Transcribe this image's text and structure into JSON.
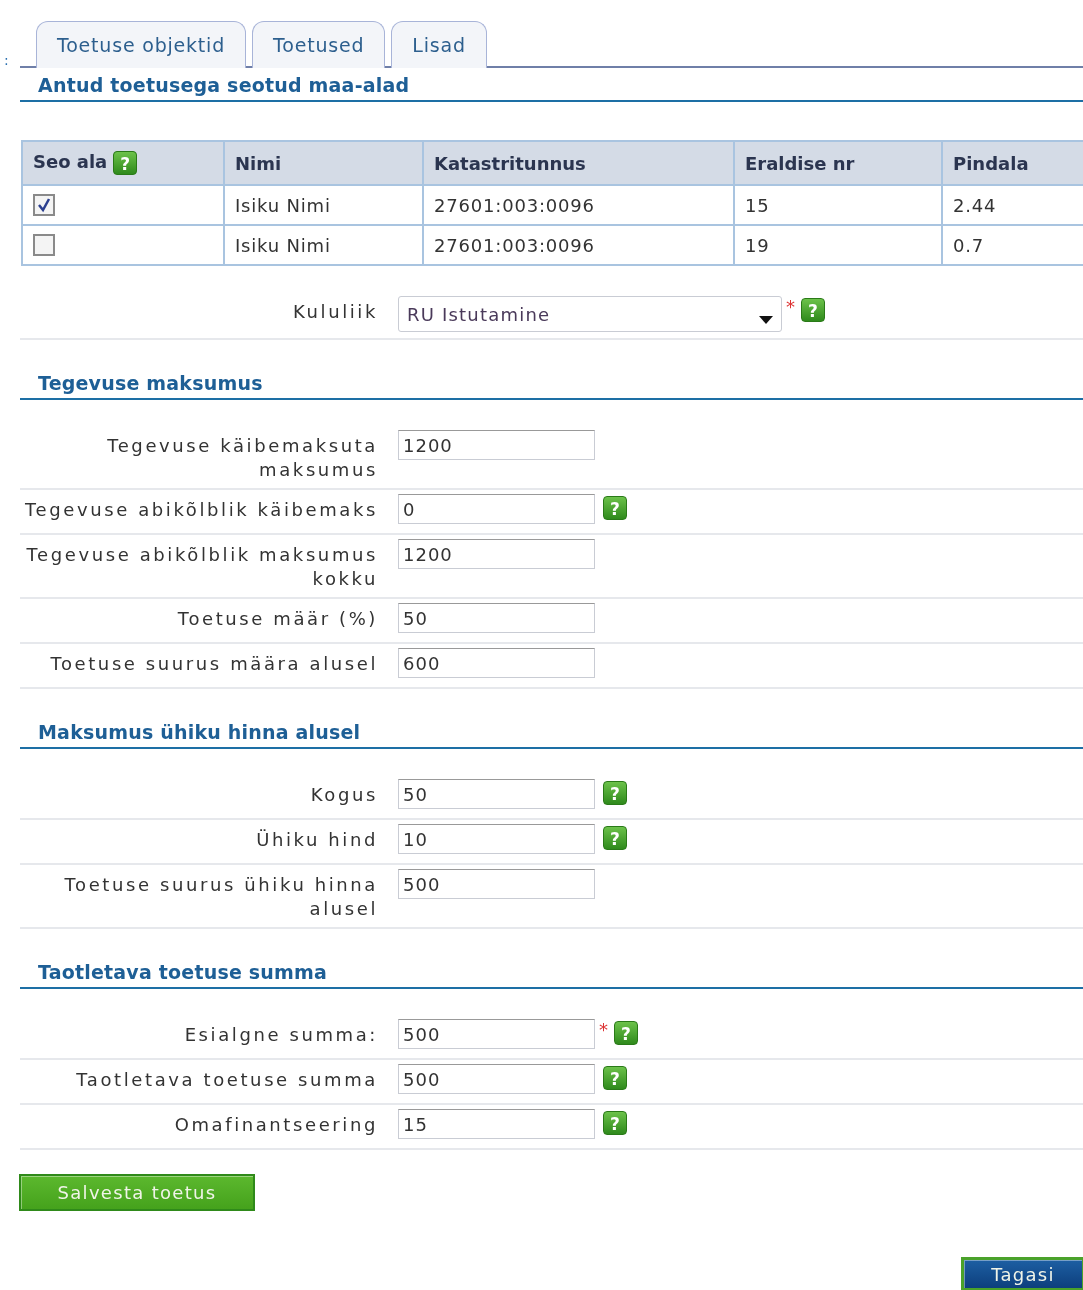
{
  "edge_mark": ":",
  "tabs": [
    {
      "label": "Toetuse objektid"
    },
    {
      "label": "Toetused"
    },
    {
      "label": "Lisad"
    }
  ],
  "land_section": {
    "title": "Antud toetusega seotud maa-alad"
  },
  "table": {
    "columns": [
      {
        "label": "Seo ala",
        "help": "?"
      },
      {
        "label": "Nimi"
      },
      {
        "label": "Katastritunnus"
      },
      {
        "label": "Eraldise nr"
      },
      {
        "label": "Pindala"
      }
    ],
    "rows": [
      {
        "cells": [
          {
            "kind": "checkbox",
            "checked": true
          },
          "Isiku Nimi",
          "27601:003:0096",
          "15",
          "2.44"
        ]
      },
      {
        "cells": [
          {
            "kind": "checkbox",
            "checked": false
          },
          "Isiku Nimi",
          "27601:003:0096",
          "19",
          "0.7"
        ]
      }
    ]
  },
  "cost_type": {
    "label": "Kululiik",
    "value": "RU Istutamine",
    "required": "*",
    "help": "?"
  },
  "sections": [
    {
      "title": "Tegevuse maksumus",
      "rows": [
        {
          "label": "Tegevuse käibemaksuta maksumus",
          "value": "1200"
        },
        {
          "label": "Tegevuse abikõlblik käibemaks",
          "value": "0",
          "help": "?"
        },
        {
          "label": "Tegevuse abikõlblik maksumus kokku",
          "value": "1200"
        },
        {
          "label": "Toetuse määr (%)",
          "value": "50"
        },
        {
          "label": "Toetuse suurus määra alusel",
          "value": "600"
        }
      ]
    },
    {
      "title": "Maksumus ühiku hinna alusel",
      "rows": [
        {
          "label": "Kogus",
          "value": "50",
          "help": "?"
        },
        {
          "label": "Ühiku hind",
          "value": "10",
          "help": "?"
        },
        {
          "label": "Toetuse suurus ühiku hinna alusel",
          "value": "500"
        }
      ]
    },
    {
      "title": "Taotletava toetuse summa",
      "rows": [
        {
          "label": "Esialgne summa:",
          "value": "500",
          "required": "*",
          "help": "?"
        },
        {
          "label": "Taotletava toetuse summa",
          "value": "500",
          "help": "?"
        },
        {
          "label": "Omafinantseering",
          "value": "15",
          "help": "?"
        }
      ]
    }
  ],
  "save_button": "Salvesta toetus",
  "back_button": "Tagasi"
}
